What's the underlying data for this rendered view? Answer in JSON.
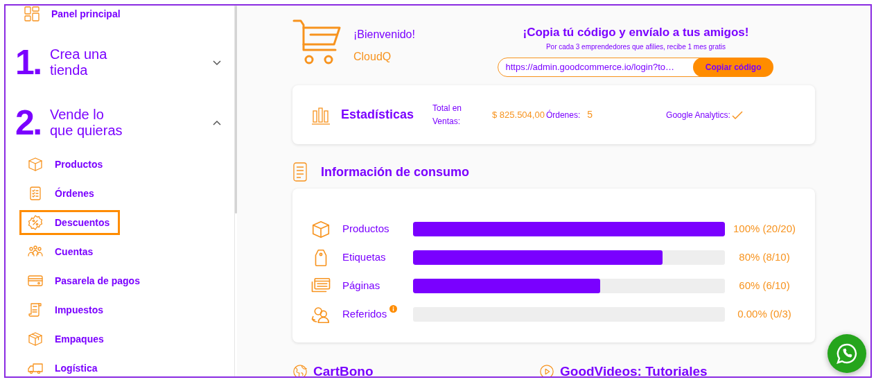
{
  "sidebar": {
    "top_item": {
      "label": "Panel principal"
    },
    "sections": [
      {
        "number": "1.",
        "title_lines": [
          "Crea una",
          "tienda"
        ],
        "expanded": false
      },
      {
        "number": "2.",
        "title_lines": [
          "Vende lo",
          "que quieras"
        ],
        "expanded": true,
        "items": [
          {
            "label": "Productos",
            "selected": false
          },
          {
            "label": "Órdenes",
            "selected": false
          },
          {
            "label": "Descuentos",
            "selected": true
          },
          {
            "label": "Cuentas",
            "selected": false
          },
          {
            "label": "Pasarela de pagos",
            "selected": false
          },
          {
            "label": "Impuestos",
            "selected": false
          },
          {
            "label": "Empaques",
            "selected": false
          },
          {
            "label": "Logística",
            "selected": false
          }
        ]
      }
    ]
  },
  "welcome": {
    "greeting": "¡Bienvenido!",
    "store": "CloudQ"
  },
  "referral": {
    "title": "¡Copia tú código y envíalo a tus amigos!",
    "subtitle": "Por cada 3 emprendedores que afilies, recibe 1 mes gratis",
    "link": "https://admin.goodcommerce.io/login?to…",
    "button": "Copiar código"
  },
  "stats": {
    "title": "Estadísticas",
    "sales_label": "Total en Ventas:",
    "sales_value": "$ 825.504,00",
    "orders_label": "Órdenes:",
    "orders_value": "5",
    "analytics_label": "Google Analytics:",
    "analytics_connected": true
  },
  "consumption": {
    "title": "Información de consumo",
    "rows": [
      {
        "label": "Productos",
        "level": 1.0,
        "reading": "100% (20/20)",
        "info": false
      },
      {
        "label": "Etiquetas",
        "level": 0.8,
        "reading": "80% (8/10)",
        "info": false
      },
      {
        "label": "Páginas",
        "level": 0.6,
        "reading": "60% (6/10)",
        "info": false
      },
      {
        "label": "Referidos",
        "level": 0.0,
        "reading": "0.00% (0/3)",
        "info": true
      }
    ]
  },
  "bottom_sections": [
    {
      "title": "CartBono"
    },
    {
      "title": "GoodVideos: Tutoriales"
    }
  ]
}
